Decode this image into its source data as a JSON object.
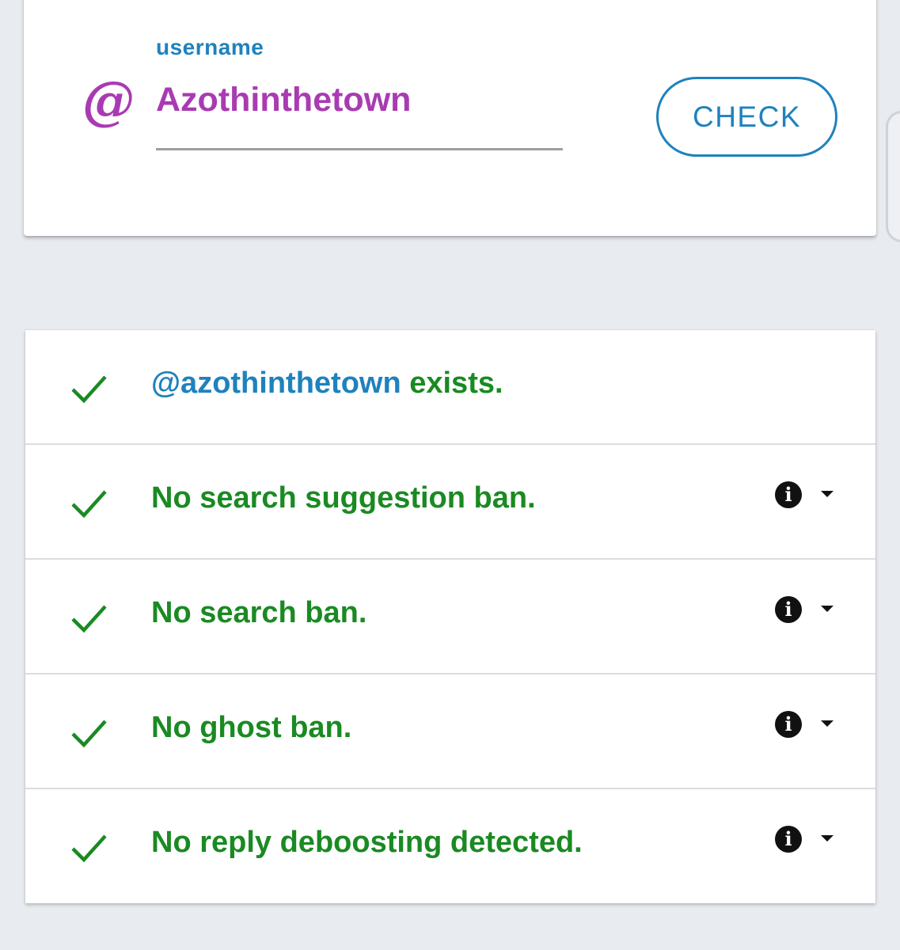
{
  "search": {
    "label": "username",
    "prefix_icon": "at-icon",
    "prefix_symbol": "@",
    "value": "Azothinthetown",
    "accent_color": "#a93bb2",
    "button_label": "CHECK"
  },
  "results": [
    {
      "status_icon": "check-icon",
      "handle": "@azothinthetown",
      "text": " exists.",
      "has_info": false
    },
    {
      "status_icon": "check-icon",
      "text": "No search suggestion ban.",
      "has_info": true,
      "info_icon": "info-icon",
      "expand_icon": "chevron-down-icon"
    },
    {
      "status_icon": "check-icon",
      "text": "No search ban.",
      "has_info": true,
      "info_icon": "info-icon",
      "expand_icon": "chevron-down-icon"
    },
    {
      "status_icon": "check-icon",
      "text": "No ghost ban.",
      "has_info": true,
      "info_icon": "info-icon",
      "expand_icon": "chevron-down-icon"
    },
    {
      "status_icon": "check-icon",
      "text": "No reply deboosting detected.",
      "has_info": true,
      "info_icon": "info-icon",
      "expand_icon": "chevron-down-icon"
    }
  ],
  "colors": {
    "success": "#1a8a22",
    "link": "#1e82bd",
    "background": "#e8ebef"
  }
}
